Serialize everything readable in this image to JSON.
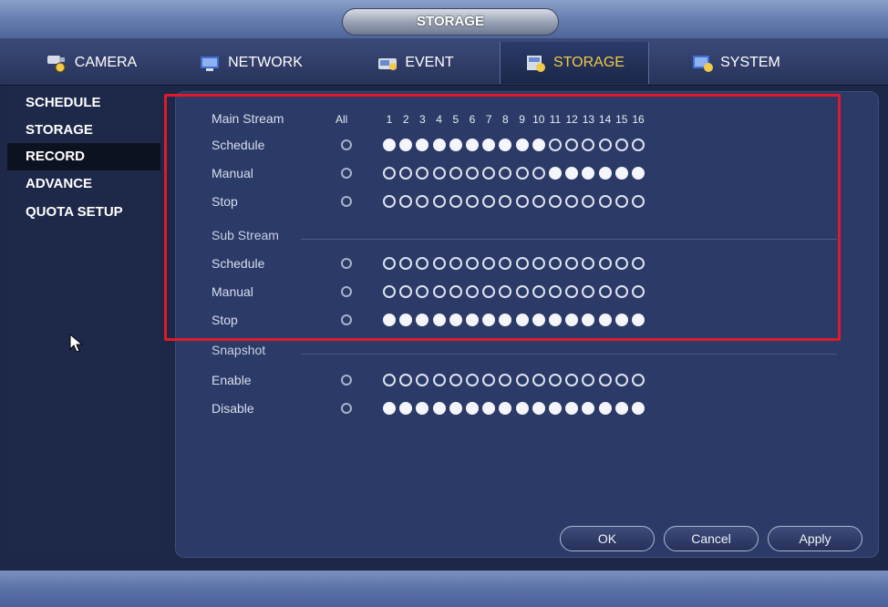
{
  "title": "STORAGE",
  "tabs": [
    {
      "label": "CAMERA",
      "icon": "camera-icon"
    },
    {
      "label": "NETWORK",
      "icon": "network-icon"
    },
    {
      "label": "EVENT",
      "icon": "event-icon"
    },
    {
      "label": "STORAGE",
      "icon": "storage-icon",
      "active": true
    },
    {
      "label": "SYSTEM",
      "icon": "system-icon"
    }
  ],
  "sidebar": {
    "items": [
      {
        "label": "SCHEDULE"
      },
      {
        "label": "STORAGE"
      },
      {
        "label": "RECORD",
        "active": true
      },
      {
        "label": "ADVANCE"
      },
      {
        "label": "QUOTA SETUP"
      }
    ]
  },
  "record": {
    "main_stream_label": "Main Stream",
    "all_label": "All",
    "channels": [
      "1",
      "2",
      "3",
      "4",
      "5",
      "6",
      "7",
      "8",
      "9",
      "10",
      "11",
      "12",
      "13",
      "14",
      "15",
      "16"
    ],
    "main_stream": [
      {
        "label": "Schedule",
        "selected": [
          1,
          1,
          1,
          1,
          1,
          1,
          1,
          1,
          1,
          1,
          0,
          0,
          0,
          0,
          0,
          0
        ]
      },
      {
        "label": "Manual",
        "selected": [
          0,
          0,
          0,
          0,
          0,
          0,
          0,
          0,
          0,
          0,
          1,
          1,
          1,
          1,
          1,
          1
        ]
      },
      {
        "label": "Stop",
        "selected": [
          0,
          0,
          0,
          0,
          0,
          0,
          0,
          0,
          0,
          0,
          0,
          0,
          0,
          0,
          0,
          0
        ]
      }
    ],
    "sub_stream_label": "Sub Stream",
    "sub_stream": [
      {
        "label": "Schedule",
        "selected": [
          0,
          0,
          0,
          0,
          0,
          0,
          0,
          0,
          0,
          0,
          0,
          0,
          0,
          0,
          0,
          0
        ]
      },
      {
        "label": "Manual",
        "selected": [
          0,
          0,
          0,
          0,
          0,
          0,
          0,
          0,
          0,
          0,
          0,
          0,
          0,
          0,
          0,
          0
        ]
      },
      {
        "label": "Stop",
        "selected": [
          1,
          1,
          1,
          1,
          1,
          1,
          1,
          1,
          1,
          1,
          1,
          1,
          1,
          1,
          1,
          1
        ]
      }
    ],
    "snapshot_label": "Snapshot",
    "snapshot": [
      {
        "label": "Enable",
        "selected": [
          0,
          0,
          0,
          0,
          0,
          0,
          0,
          0,
          0,
          0,
          0,
          0,
          0,
          0,
          0,
          0
        ]
      },
      {
        "label": "Disable",
        "selected": [
          1,
          1,
          1,
          1,
          1,
          1,
          1,
          1,
          1,
          1,
          1,
          1,
          1,
          1,
          1,
          1
        ]
      }
    ]
  },
  "buttons": {
    "ok": "OK",
    "cancel": "Cancel",
    "apply": "Apply"
  },
  "colors": {
    "accent": "#f2c94c",
    "highlight": "#e01a2a",
    "panel": "#2b3a66"
  }
}
